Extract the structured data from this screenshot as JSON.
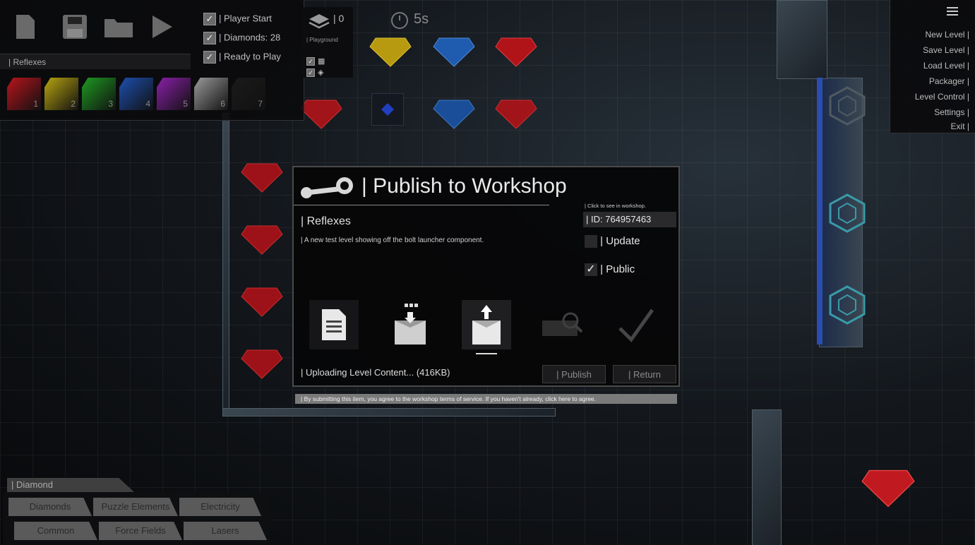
{
  "toolbar": {
    "checks": [
      {
        "label": "| Player Start",
        "checked": true
      },
      {
        "label": "| Diamonds: 28",
        "checked": true
      },
      {
        "label": "| Ready to Play",
        "checked": true
      }
    ],
    "level_name": "| Reflexes",
    "color_slots": [
      {
        "num": "1",
        "color": "#b8141c"
      },
      {
        "num": "2",
        "color": "#b8a40f"
      },
      {
        "num": "3",
        "color": "#1e9a22"
      },
      {
        "num": "4",
        "color": "#1d4fb0"
      },
      {
        "num": "5",
        "color": "#8a20a8"
      },
      {
        "num": "6",
        "color": "#9a9a9a"
      },
      {
        "num": "7",
        "color": "#1a1a1a"
      }
    ]
  },
  "layer": {
    "count": "| 0",
    "name": "| Playground"
  },
  "timer": "5s",
  "right_menu": [
    "New Level |",
    "Save Level |",
    "Load Level |",
    "Packager |",
    "Level Control |",
    "Settings |",
    "Exit |"
  ],
  "dialog": {
    "title": "| Publish to Workshop",
    "level_title": "| Reflexes",
    "description": "| A new test level showing off the bolt launcher component.",
    "click_hint": "| Click to see in workshop.",
    "id": "| ID: 764957463",
    "update_label": "| Update",
    "update_checked": false,
    "public_label": "| Public",
    "public_checked": true,
    "status": "| Uploading Level Content... (416KB)",
    "publish_label": "| Publish",
    "return_label": "| Return",
    "terms": "| By submitting this item, you agree to the workshop terms of service. If you haven't already, click here to agree."
  },
  "category": {
    "label": "| Diamond",
    "row1": [
      "Diamonds",
      "Puzzle Elements",
      "Electricity"
    ],
    "row2": [
      "Common",
      "Force Fields",
      "Lasers"
    ]
  }
}
